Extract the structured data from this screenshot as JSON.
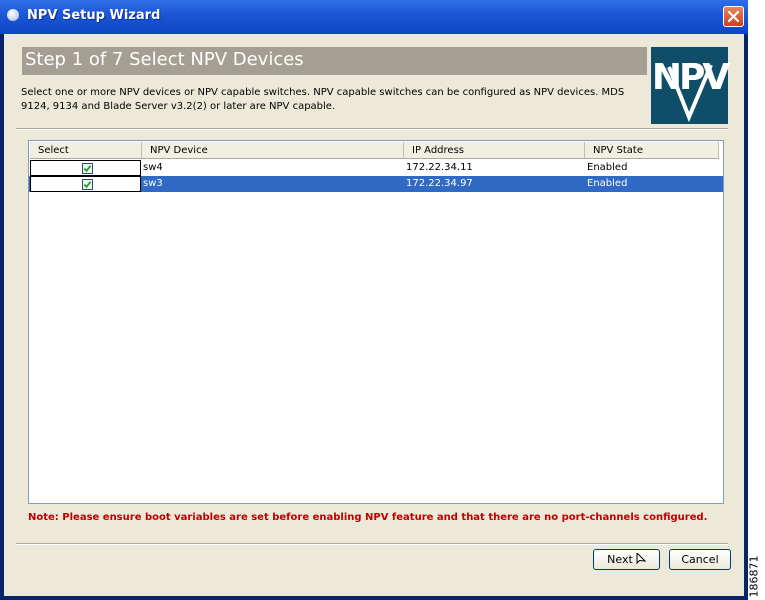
{
  "window": {
    "title": "NPV Setup Wizard"
  },
  "wizard": {
    "step_title": "Step 1 of 7 Select NPV Devices",
    "intro": "Select one or more NPV devices or NPV capable switches.  NPV capable switches can be configured as NPV devices.  MDS 9124, 9134 and Blade Server v3.2(2) or later are NPV capable.",
    "logo_text": "NPV"
  },
  "table": {
    "columns": [
      "Select",
      "NPV Device",
      "IP Address",
      "NPV State"
    ],
    "rows": [
      {
        "selected": true,
        "device": "sw4",
        "ip": "172.22.34.11",
        "state": "Enabled",
        "highlighted": false
      },
      {
        "selected": true,
        "device": "sw3",
        "ip": "172.22.34.97",
        "state": "Enabled",
        "highlighted": true
      }
    ]
  },
  "note": "Note: Please ensure boot variables are set before enabling NPV feature and that there are no port-channels configured.",
  "buttons": {
    "next": "Next",
    "cancel": "Cancel"
  },
  "figure_id": "186871",
  "colors": {
    "selection": "#316ac5",
    "note": "#c00000",
    "logo_bg": "#0f4d68",
    "banner_bg": "#a59f93"
  }
}
